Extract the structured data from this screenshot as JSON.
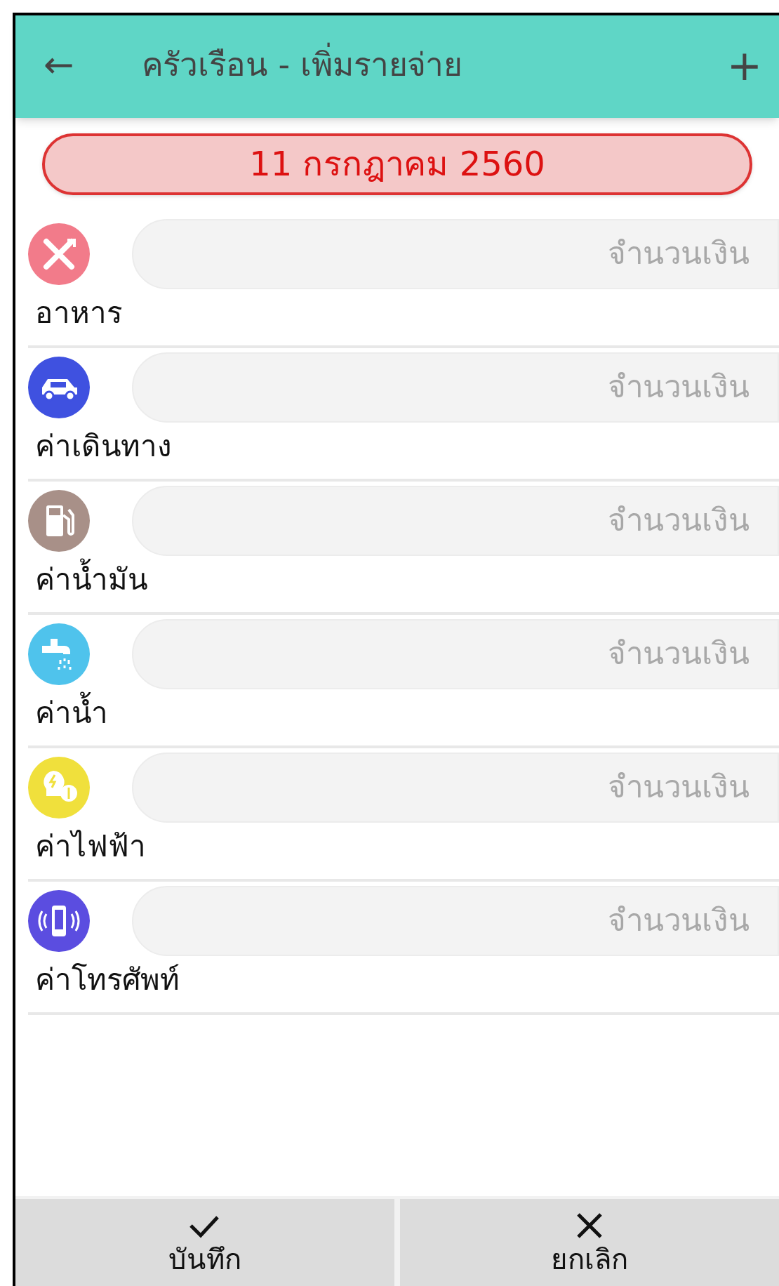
{
  "app_bar": {
    "back": "←",
    "title": "ครัวเรือน - เพิ่มรายจ่าย",
    "add": "+"
  },
  "date": "11 กรกฎาคม 2560",
  "categories": [
    {
      "kind": "food",
      "color": "#f27b8a",
      "label": "อาหาร",
      "placeholder": "จำนวนเงิน"
    },
    {
      "kind": "car",
      "color": "#3f51e0",
      "label": "ค่าเดินทาง",
      "placeholder": "จำนวนเงิน"
    },
    {
      "kind": "fuel",
      "color": "#a89088",
      "label": "ค่าน้ำมัน",
      "placeholder": "จำนวนเงิน"
    },
    {
      "kind": "water",
      "color": "#4fc3ec",
      "label": "ค่าน้ำ",
      "placeholder": "จำนวนเงิน"
    },
    {
      "kind": "electric",
      "color": "#f0e03c",
      "label": "ค่าไฟฟ้า",
      "placeholder": "จำนวนเงิน"
    },
    {
      "kind": "phone",
      "color": "#5b4de0",
      "label": "ค่าโทรศัพท์",
      "placeholder": "จำนวนเงิน"
    }
  ],
  "buttons": [
    {
      "kind": "save",
      "label": "บันทึก"
    },
    {
      "kind": "cancel",
      "label": "ยกเลิก"
    }
  ]
}
